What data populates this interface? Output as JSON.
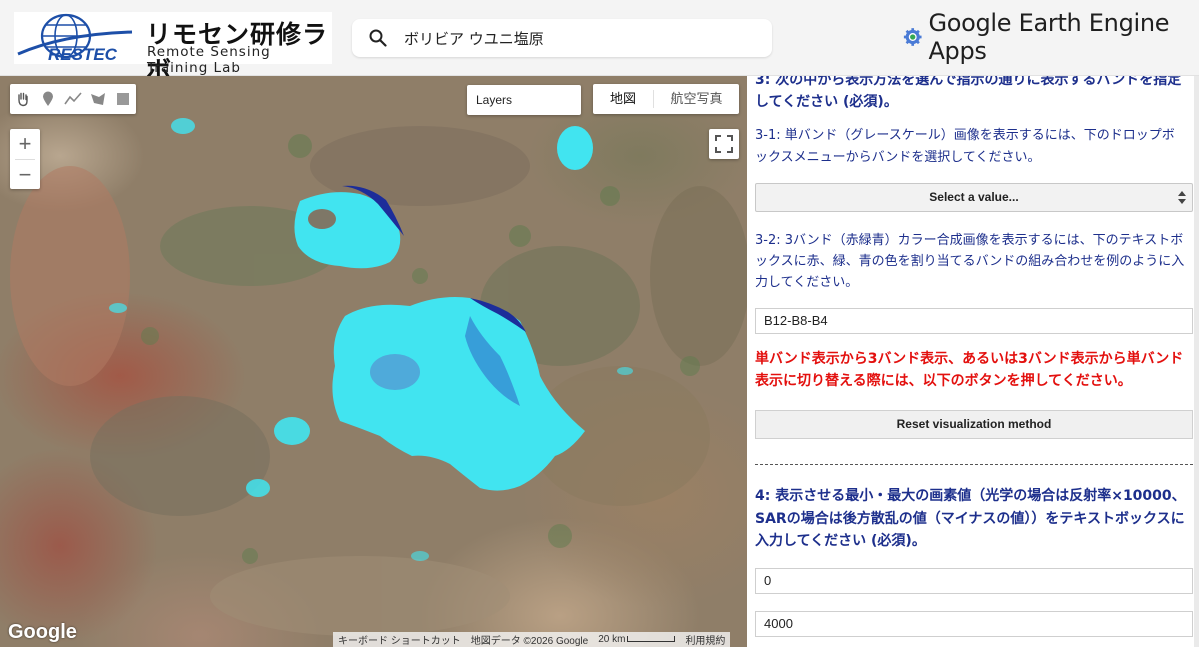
{
  "header": {
    "logo_title": "リモセン研修ラボ",
    "logo_subtitle": "Remote Sensing Training Lab",
    "logo_mark": "RESTEC",
    "search_value": "ボリビア ウユニ塩原",
    "brand_title": "Google Earth Engine Apps"
  },
  "map": {
    "tools": [
      "hand-icon",
      "marker-icon",
      "polyline-icon",
      "polygon-icon",
      "rectangle-icon"
    ],
    "zoom_in": "+",
    "zoom_out": "−",
    "layers_label": "Layers",
    "map_types": [
      "地図",
      "航空写真"
    ],
    "google_logo": "Google",
    "attribution": {
      "shortcuts": "キーボード ショートカット",
      "map_data": "地図データ ©2026 Google",
      "scale": "20 km",
      "terms": "利用規約"
    },
    "colors": {
      "salt_flat": "#41e4f0",
      "water": "#1c2d9a"
    }
  },
  "panel": {
    "step3_heading": "3: 次の中から表示方法を選んで指示の通りに表示するバンドを指定してください (必須)。",
    "step31_text": "3-1: 単バンド（グレースケール）画像を表示するには、下のドロップボックスメニューからバンドを選択してください。",
    "select_placeholder": "Select a value...",
    "step32_text": "3-2: 3バンド（赤緑青）カラー合成画像を表示するには、下のテキストボックスに赤、緑、青の色を割り当てるバンドの組み合わせを例のように入力してください。",
    "band_combo_value": "B12-B8-B4",
    "warning_text": "単バンド表示から3バンド表示、あるいは3バンド表示から単バンド表示に切り替える際には、以下のボタンを押してください。",
    "reset_button": "Reset visualization method",
    "step4_heading": "4: 表示させる最小・最大の画素値（光学の場合は反射率×10000、SARの場合は後方散乱の値（マイナスの値））をテキストボックスに入力してください (必須)。",
    "min_value": "0",
    "max_value": "4000",
    "colors": {
      "heading": "#1d2f8c",
      "warning": "#e3100e"
    }
  }
}
